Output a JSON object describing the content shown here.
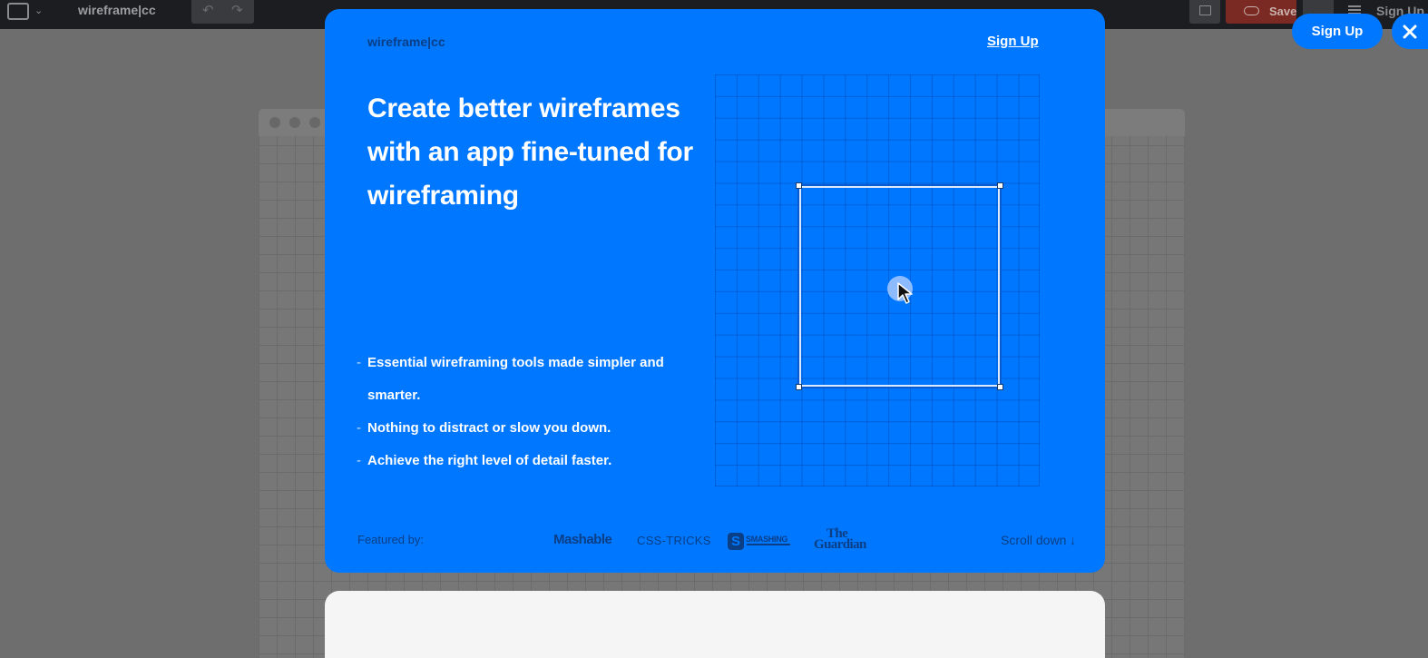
{
  "background_app": {
    "brand": "wireframe|cc",
    "icons": {
      "window": "window-icon",
      "caret": "chevron-down-icon",
      "undo": "undo-icon",
      "redo": "redo-icon",
      "comment": "comment-icon",
      "save": "cloud-upload-icon",
      "filter": "sliders-icon",
      "menu": "menu-icon"
    },
    "save_label": "Save",
    "signup_label": "Sign Up"
  },
  "modal": {
    "brand": "wireframe|cc",
    "signup_link": "Sign Up",
    "headline": "Create better wireframes with an app fine-tuned for wireframing",
    "features": [
      "Essential wireframing tools made simpler and smarter.",
      "Nothing to distract or slow you down.",
      "Achieve the right level of detail faster."
    ],
    "featured_label": "Featured by:",
    "logos": {
      "mashable": "Mashable",
      "csstricks": "CSS-TRICKS",
      "smashing_mark": "S",
      "smashing": "SMASHING",
      "guardian_line1": "The",
      "guardian_line2": "Guardian"
    },
    "scroll_label": "Scroll down",
    "scroll_arrow": "↓"
  },
  "floating": {
    "signup_label": "Sign Up",
    "close_icon": "close-icon"
  },
  "colors": {
    "accent": "#0077ff",
    "overlay": "#6e6e6e",
    "muted_text": "#0a3f86",
    "save_button": "#7a2a22"
  }
}
